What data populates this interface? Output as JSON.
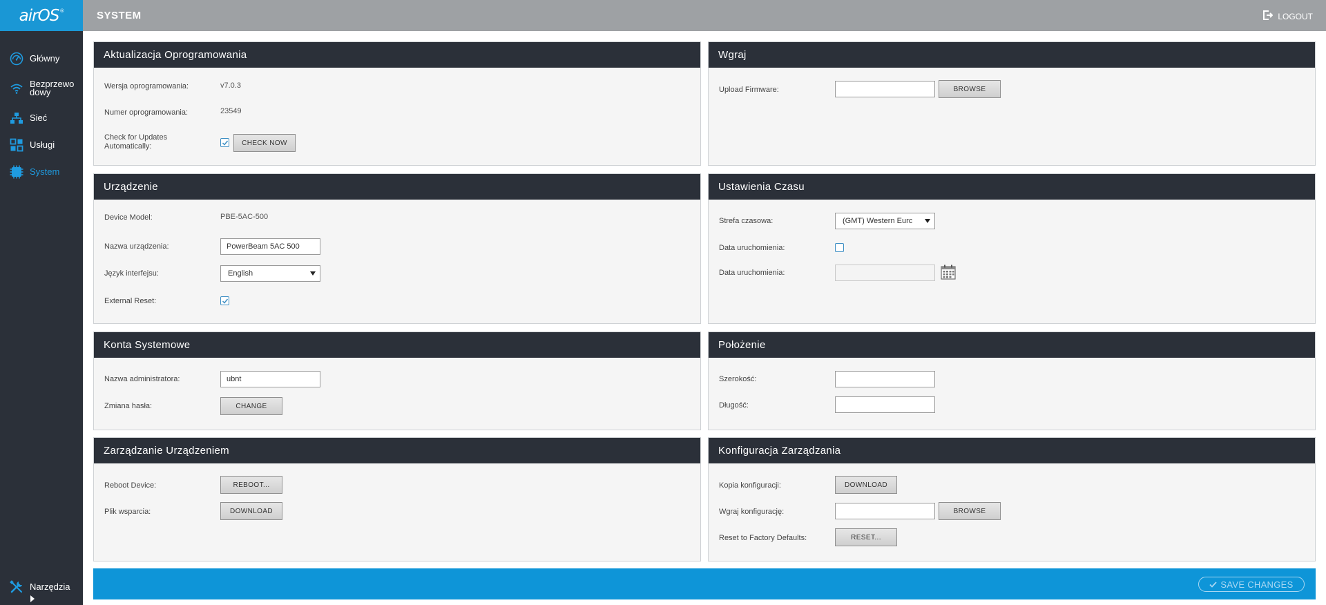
{
  "logo": {
    "text": "airOS",
    "mark": "®"
  },
  "header": {
    "title": "SYSTEM",
    "logout": "LOGOUT"
  },
  "nav": {
    "items": [
      {
        "label": "Główny",
        "icon": "dashboard-icon"
      },
      {
        "label": "Bezprzewodowy",
        "label_line1": "Bezprzewo",
        "label_line2": "dowy",
        "icon": "wifi-icon"
      },
      {
        "label": "Sieć",
        "icon": "network-icon"
      },
      {
        "label": "Usługi",
        "icon": "services-icon"
      },
      {
        "label": "System",
        "icon": "system-icon",
        "active": true
      }
    ],
    "tools": {
      "label": "Narzędzia",
      "icon": "tools-icon"
    }
  },
  "firmware": {
    "title": "Aktualizacja Oprogramowania",
    "version_label": "Wersja oprogramowania:",
    "version": "v7.0.3",
    "build_label": "Numer oprogramowania:",
    "build": "23549",
    "check_label_line1": "Check for Updates",
    "check_label_line2": "Automatically:",
    "check_checked": true,
    "check_button": "CHECK NOW"
  },
  "upload": {
    "title": "Wgraj",
    "firmware_label": "Upload Firmware:",
    "firmware_value": "",
    "browse_button": "BROWSE"
  },
  "device": {
    "title": "Urządzenie",
    "model_label": "Device Model:",
    "model": "PBE-5AC-500",
    "name_label": "Nazwa urządzenia:",
    "name_value": "PowerBeam 5AC 500",
    "language_label": "Język interfejsu:",
    "language_value": "English",
    "reset_label": "External Reset:",
    "reset_checked": true
  },
  "time": {
    "title": "Ustawienia Czasu",
    "timezone_label": "Strefa czasowa:",
    "timezone_value": "(GMT) Western Eurc",
    "startup_label": "Data uruchomienia:",
    "startup_checked": false,
    "startup_date_label": "Data uruchomienia:",
    "startup_date_value": ""
  },
  "accounts": {
    "title": "Konta Systemowe",
    "admin_label": "Nazwa administratora:",
    "admin_value": "ubnt",
    "password_label": "Zmiana hasła:",
    "change_button": "CHANGE"
  },
  "location": {
    "title": "Położenie",
    "latitude_label": "Szerokość:",
    "latitude_value": "",
    "longitude_label": "Długość:",
    "longitude_value": ""
  },
  "management": {
    "title": "Zarządzanie Urządzeniem",
    "reboot_label": "Reboot Device:",
    "reboot_button": "REBOOT...",
    "support_label": "Plik wsparcia:",
    "support_button": "DOWNLOAD"
  },
  "config": {
    "title": "Konfiguracja Zarządzania",
    "backup_label": "Kopia konfiguracji:",
    "backup_button": "DOWNLOAD",
    "upload_label": "Wgraj konfigurację:",
    "upload_value": "",
    "upload_button": "BROWSE",
    "factory_label": "Reset to Factory Defaults:",
    "factory_button": "RESET..."
  },
  "save": {
    "label": "SAVE CHANGES"
  }
}
